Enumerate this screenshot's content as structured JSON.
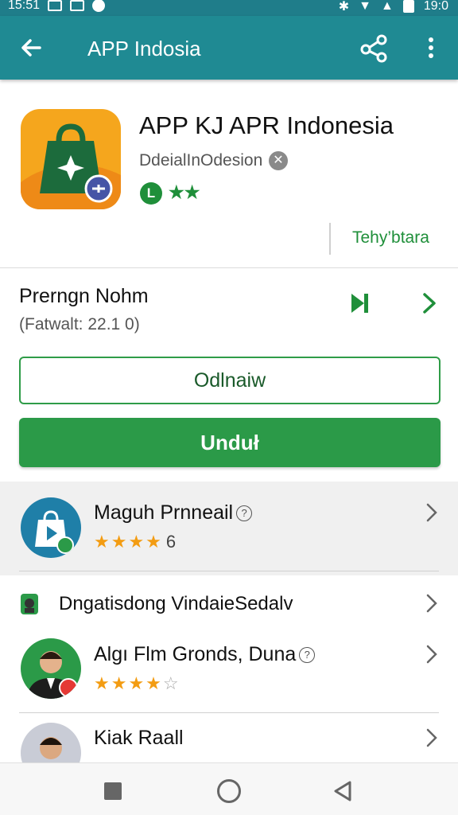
{
  "status_bar": {
    "time_left": "15:51",
    "time_right": "19:0"
  },
  "app_bar": {
    "title": "APP Indosia"
  },
  "app": {
    "name": "APP KJ APR Indonesia",
    "developer": "DdeialInOdesion",
    "badge_a": "L",
    "badge_b": "★★",
    "install_link": "Tehy’btara"
  },
  "version": {
    "title": "Prerngn Nohm",
    "subtitle": "(Fatwalt: 22.1 0)"
  },
  "buttons": {
    "outline_label": "Odlnaiw",
    "primary_label": "Unduł"
  },
  "list": [
    {
      "title": "Maguh Prnneail",
      "stars_filled": "★★★★",
      "stars_empty": "",
      "count": "6"
    },
    {
      "title": "Dngatisdong VindaieSedalv"
    },
    {
      "title": "Algı Flm Gronds, Duna",
      "stars_filled": "★★★★",
      "stars_empty": "☆"
    },
    {
      "title": "Kiak Raall"
    }
  ],
  "colors": {
    "accent_teal": "#1f8a93",
    "brand_green": "#2b9a48",
    "star": "#f39c12"
  }
}
